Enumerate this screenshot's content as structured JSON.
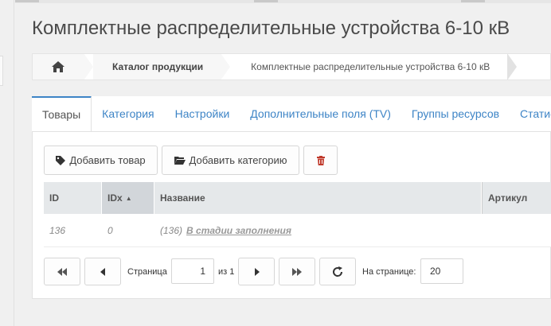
{
  "page": {
    "title": "Комплектные распределительные устройства 6-10 кВ"
  },
  "breadcrumb": {
    "home_icon": "home-icon",
    "items": [
      "Каталог продукции",
      "Комплектные распределительные устройства 6-10 кВ"
    ]
  },
  "tabs": [
    {
      "label": "Товары",
      "active": true
    },
    {
      "label": "Категория",
      "active": false
    },
    {
      "label": "Настройки",
      "active": false
    },
    {
      "label": "Дополнительные поля (TV)",
      "active": false
    },
    {
      "label": "Группы ресурсов",
      "active": false
    },
    {
      "label": "Статис",
      "active": false
    }
  ],
  "toolbar": {
    "add_product_label": "Добавить товар",
    "add_product_icon": "tag-icon",
    "add_category_label": "Добавить категорию",
    "add_category_icon": "folder-open-icon",
    "delete_icon": "trash-icon"
  },
  "grid": {
    "columns": [
      "ID",
      "IDx",
      "Название",
      "Артикул"
    ],
    "sorted_column": "IDx",
    "rows": [
      {
        "id": "136",
        "idx": "0",
        "name_prefix": "(136)",
        "name": "В стадии заполнения"
      }
    ]
  },
  "pagination": {
    "page_label": "Страница",
    "page_value": "1",
    "of_label": "из 1",
    "per_page_label": "На странице:",
    "per_page_value": "20"
  },
  "colors": {
    "accent": "#3d84c6",
    "delete": "#c0392b"
  }
}
